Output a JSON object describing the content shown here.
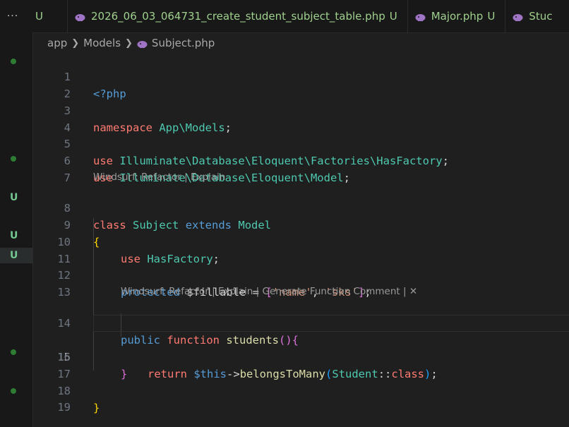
{
  "tabs": [
    {
      "label": "",
      "modified": "U"
    },
    {
      "label": "2026_06_03_064731_create_student_subject_table.php",
      "modified": "U"
    },
    {
      "label": "Major.php",
      "modified": "U"
    },
    {
      "label": "Stuc",
      "modified": ""
    }
  ],
  "tab_overflow": "···",
  "breadcrumb": {
    "parts": [
      "app",
      "Models",
      "Subject.php"
    ]
  },
  "codelens": {
    "class": "Windsurf: Refactor | Explain",
    "method": "Windsurf: Refactor | Explain | Generate Function Comment | ✕"
  },
  "git_markers": [
    "U",
    "U",
    "U"
  ],
  "lines": [
    {
      "n": "1"
    },
    {
      "n": "2"
    },
    {
      "n": "3"
    },
    {
      "n": "4"
    },
    {
      "n": "5"
    },
    {
      "n": "6"
    },
    {
      "n": "7"
    },
    {
      "n": "8"
    },
    {
      "n": "9"
    },
    {
      "n": "10"
    },
    {
      "n": "11"
    },
    {
      "n": "12"
    },
    {
      "n": "13"
    },
    {
      "n": "14"
    },
    {
      "n": "15"
    },
    {
      "n": "16"
    },
    {
      "n": "17"
    },
    {
      "n": "18"
    },
    {
      "n": "19"
    }
  ],
  "code": {
    "l1": "<?php",
    "l3_kw": "namespace",
    "l3_ns": "App\\Models",
    "l3_end": ";",
    "l5_kw": "use",
    "l5_ns": "Illuminate\\Database\\Eloquent\\Factories\\",
    "l5_cls": "HasFactory",
    "l5_end": ";",
    "l6_kw": "use",
    "l6_ns": "Illuminate\\Database\\Eloquent\\",
    "l6_cls": "Model",
    "l6_end": ";",
    "l8_kw": "class",
    "l8_cls": "Subject",
    "l8_ext": "extends",
    "l8_parent": "Model",
    "l9": "{",
    "l10_kw": "use",
    "l10_cls": "HasFactory",
    "l10_end": ";",
    "l12_kw": "protected",
    "l12_var": "$fillable",
    "l12_eq": " = ",
    "l12_b1": "[",
    "l12_s1": "'name'",
    "l12_comma": ", ",
    "l12_s2": "'sks'",
    "l12_b2": "]",
    "l12_end": ";",
    "l14_kw": "public",
    "l14_fn_kw": "function",
    "l14_fn": "students",
    "l14_p": "()",
    "l14_b": "{",
    "l15_kw": "return",
    "l15_this": "$this",
    "l15_arrow": "->",
    "l15_fn": "belongsToMany",
    "l15_p1": "(",
    "l15_cls": "Student",
    "l15_dc": "::",
    "l15_class": "class",
    "l15_p2": ")",
    "l15_end": ";",
    "l16": "}",
    "l18": "}"
  }
}
